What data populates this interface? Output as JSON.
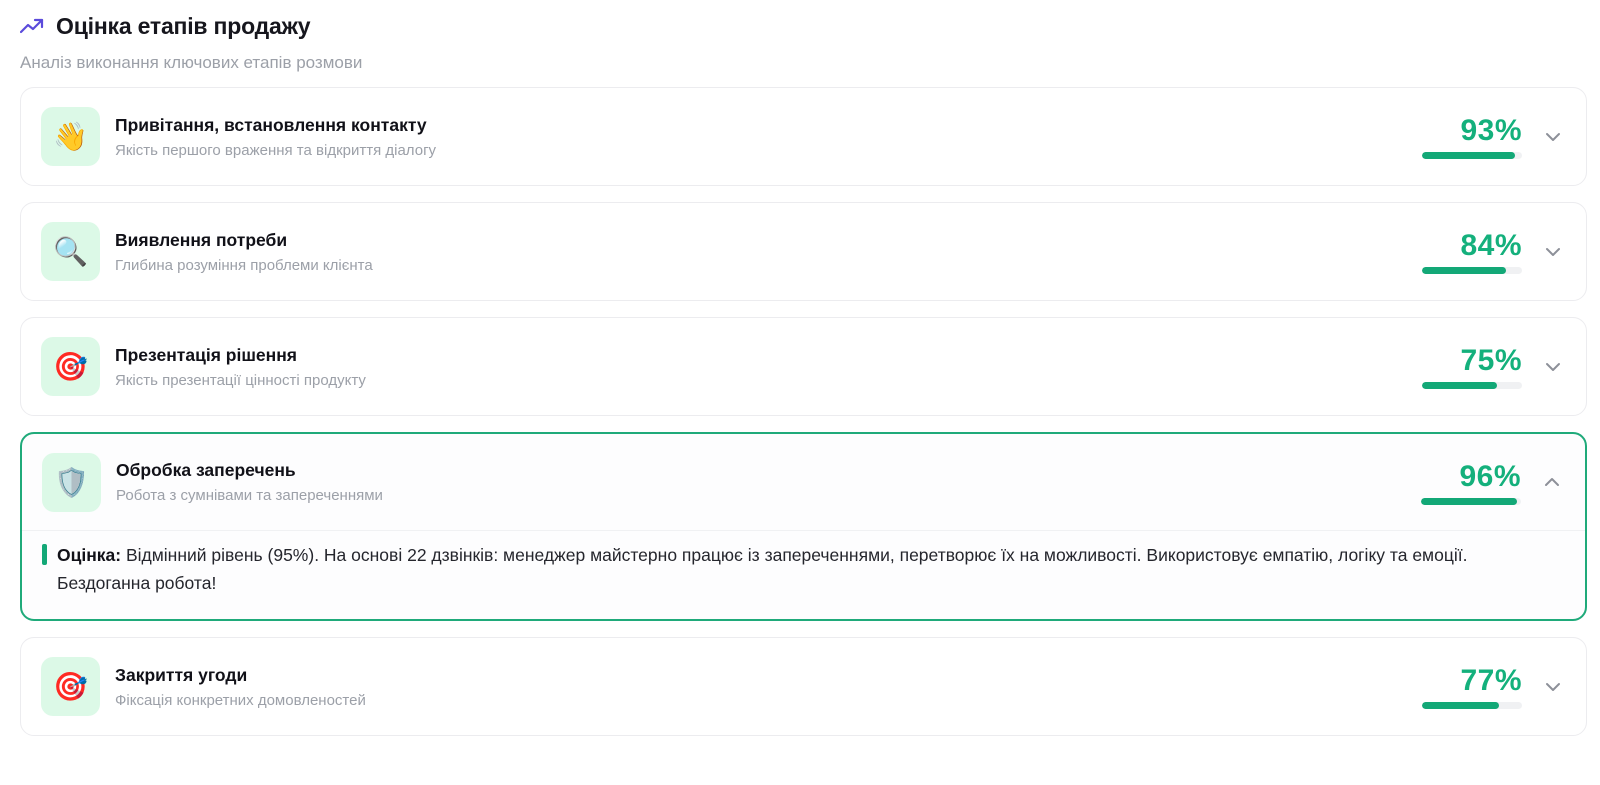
{
  "header": {
    "title": "Оцінка етапів продажу",
    "subtitle": "Аналіз виконання ключових етапів розмови",
    "icon": "trending-up-icon",
    "icon_color": "#5b4bdb"
  },
  "colors": {
    "accent": "#13a877",
    "icon_bg": "#dcf9e7",
    "expanded_border": "#1faa7a"
  },
  "stages": [
    {
      "icon": "waving-hand-emoji",
      "emoji": "👋",
      "name": "Привітання, встановлення контакту",
      "description": "Якість першого враження та відкриття діалогу",
      "score_text": "93%",
      "score": 93,
      "expanded": false
    },
    {
      "icon": "magnifying-glass-emoji",
      "emoji": "🔍",
      "name": "Виявлення потреби",
      "description": "Глибина розуміння проблеми клієнта",
      "score_text": "84%",
      "score": 84,
      "expanded": false
    },
    {
      "icon": "target-emoji",
      "emoji": "🎯",
      "name": "Презентація рішення",
      "description": "Якість презентації цінності продукту",
      "score_text": "75%",
      "score": 75,
      "expanded": false
    },
    {
      "icon": "shield-emoji",
      "emoji": "🛡️",
      "name": "Обробка заперечень",
      "description": "Робота з сумнівами та запереченнями",
      "score_text": "96%",
      "score": 96,
      "expanded": true,
      "comment_label": "Оцінка:",
      "comment": " Відмінний рівень (95%). На основі 22 дзвінків: менеджер майстерно працює із запереченнями, перетворює їх на можливості. Використовує емпатію, логіку та емоції. Бездоганна робота!"
    },
    {
      "icon": "target-emoji",
      "emoji": "🎯",
      "name": "Закриття угоди",
      "description": "Фіксація конкретних домовленостей",
      "score_text": "77%",
      "score": 77,
      "expanded": false
    }
  ]
}
